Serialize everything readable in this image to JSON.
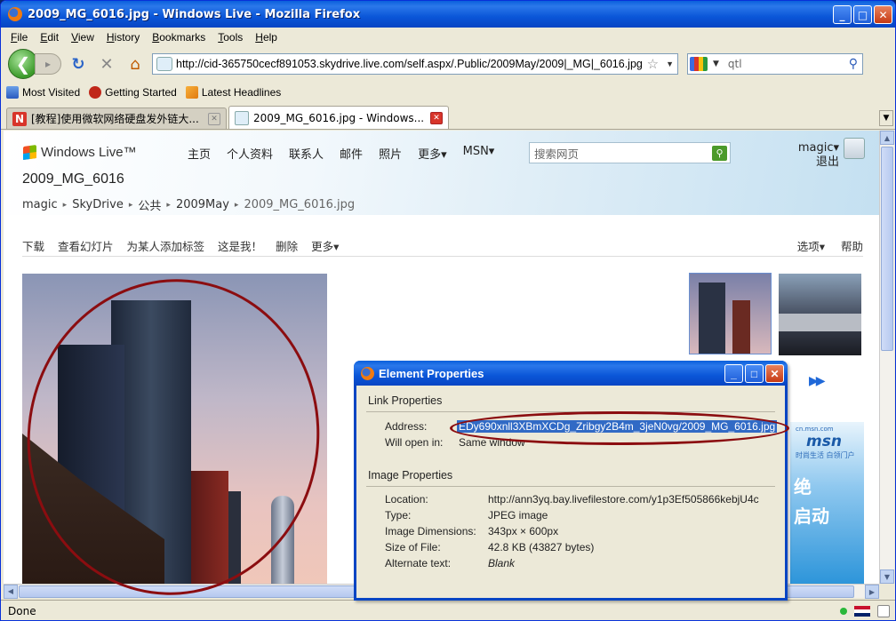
{
  "window": {
    "title": "2009_MG_6016.jpg - Windows Live - Mozilla Firefox",
    "minimize": "_",
    "maximize": "□",
    "close": "✕"
  },
  "menu": [
    "File",
    "Edit",
    "View",
    "History",
    "Bookmarks",
    "Tools",
    "Help"
  ],
  "nav": {
    "url": "http://cid-365750cecf891053.skydrive.live.com/self.aspx/.Public/2009May/2009|_MG|_6016.jpg",
    "search_value": "qtl"
  },
  "bookmarks": [
    "Most Visited",
    "Getting Started",
    "Latest Headlines"
  ],
  "tabs": [
    {
      "label": "[教程]使用微软网络硬盘发外链大..."
    },
    {
      "label": "2009_MG_6016.jpg - Windows..."
    }
  ],
  "page": {
    "logo": "Windows Live™",
    "topnav": [
      "主页",
      "个人资料",
      "联系人",
      "邮件",
      "照片",
      "更多▾",
      "MSN▾"
    ],
    "search_placeholder": "搜索网页",
    "user_name": "magic▾",
    "signout": "退出",
    "title": "2009_MG_6016",
    "breadcrumb": [
      "magic",
      "SkyDrive",
      "公共",
      "2009May",
      "2009_MG_6016.jpg"
    ],
    "actions": [
      "下载",
      "查看幻灯片",
      "为某人添加标签",
      "这是我！",
      "删除",
      "更多▾"
    ],
    "actions_right": [
      "选项▾",
      "帮助"
    ],
    "ad_site": "cn.msn.com",
    "ad_logo": "msn",
    "ad_tagline": "时尚生活 白领门户",
    "ad_text1": "绝",
    "ad_text2": "启动"
  },
  "dialog": {
    "title": "Element Properties",
    "link_group": "Link Properties",
    "address_label": "Address:",
    "address_value": "EDy690xnll3XBmXCDg_Zribgy2B4m_3jeN0vg/2009_MG_6016.jpg",
    "open_label": "Will open in:",
    "open_value": "Same window",
    "image_group": "Image Properties",
    "location_label": "Location:",
    "location_value": "http://ann3yq.bay.livefilestore.com/y1p3Ef505866kebjU4c",
    "type_label": "Type:",
    "type_value": "JPEG image",
    "dims_label": "Image Dimensions:",
    "dims_value": "343px × 600px",
    "size_label": "Size of File:",
    "size_value": "42.8 KB (43827 bytes)",
    "alt_label": "Alternate text:",
    "alt_value": "Blank"
  },
  "status": {
    "text": "Done"
  }
}
